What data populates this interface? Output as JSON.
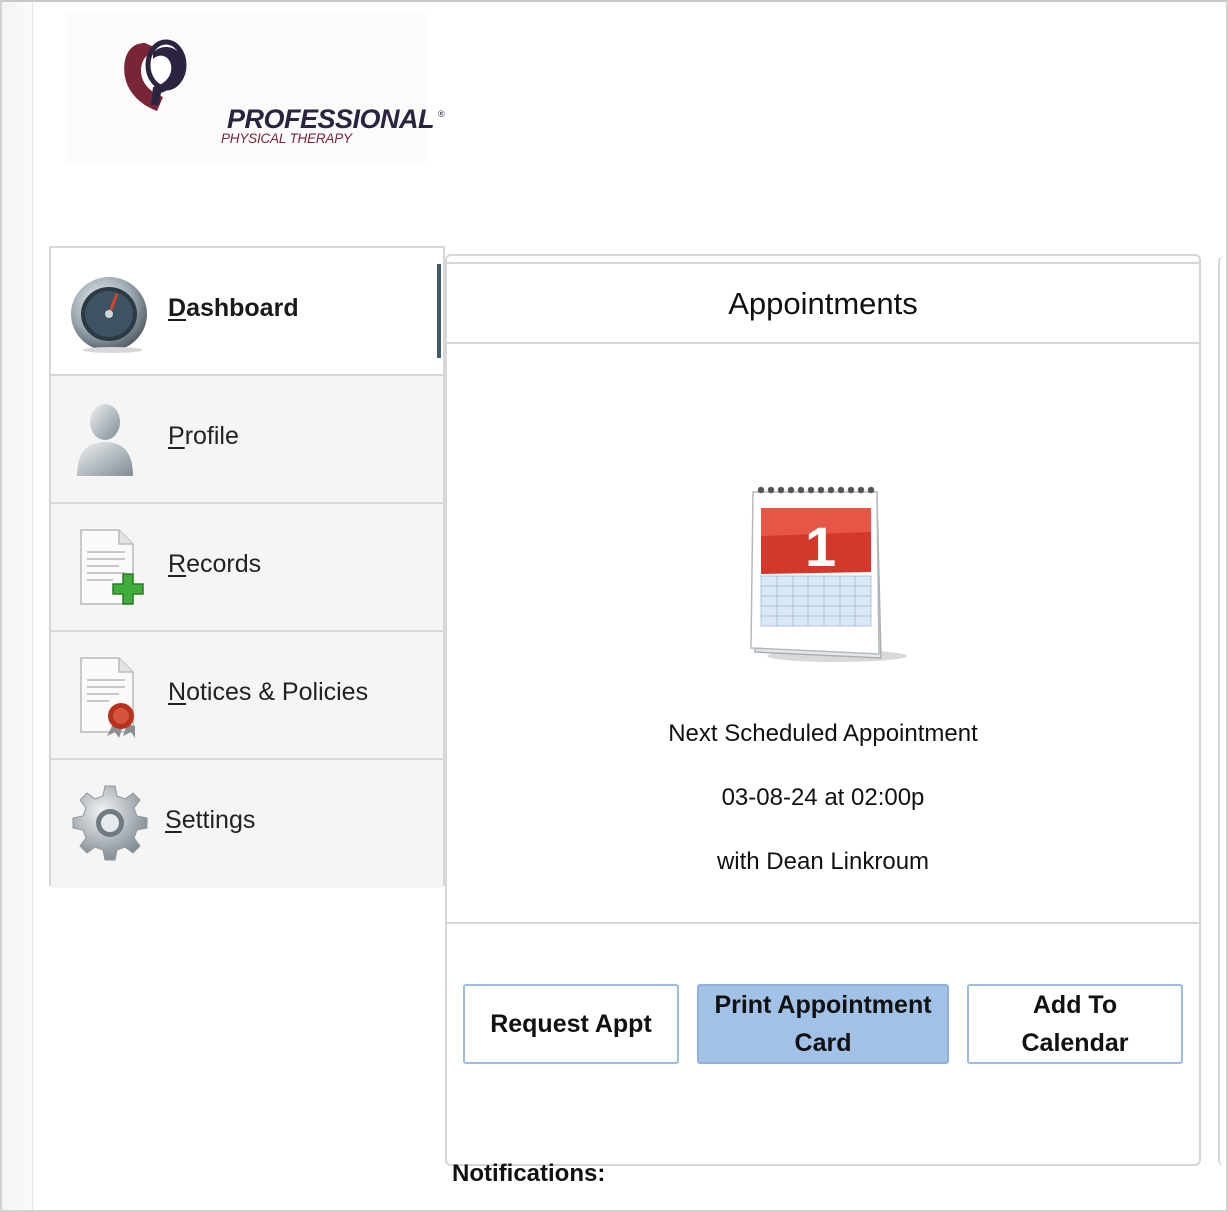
{
  "logo": {
    "name": "PROFESSIONAL",
    "reg_mark": "®",
    "subtitle": "PHYSICAL THERAPY"
  },
  "sidebar": {
    "items": [
      {
        "label_first": "D",
        "label_rest": "ashboard",
        "icon": "dashboard-gauge-icon",
        "active": true
      },
      {
        "label_first": "P",
        "label_rest": "rofile",
        "icon": "user-silhouette-icon",
        "active": false
      },
      {
        "label_first": "R",
        "label_rest": "ecords",
        "icon": "document-add-icon",
        "active": false
      },
      {
        "label_first": "N",
        "label_rest": "otices & Policies",
        "icon": "document-seal-icon",
        "active": false
      },
      {
        "label_first": "S",
        "label_rest": "ettings",
        "icon": "gear-icon",
        "active": false
      }
    ]
  },
  "appointments": {
    "title": "Appointments",
    "calendar_icon": "calendar-icon",
    "calendar_day": "1",
    "next_label": "Next Scheduled Appointment",
    "datetime": "03-08-24 at 02:00p",
    "provider": "with Dean Linkroum",
    "buttons": {
      "request": "Request Appt",
      "print_line1": "Print Appointment",
      "print_line2": "Card",
      "add_line1": "Add To",
      "add_line2": "Calendar"
    }
  },
  "notifications_label": "Notifications:",
  "colors": {
    "accent_button": "#a2c1e6",
    "button_border": "#9bbbe0",
    "active_bar": "#3e5a6b",
    "logo_maroon": "#7a2438"
  }
}
